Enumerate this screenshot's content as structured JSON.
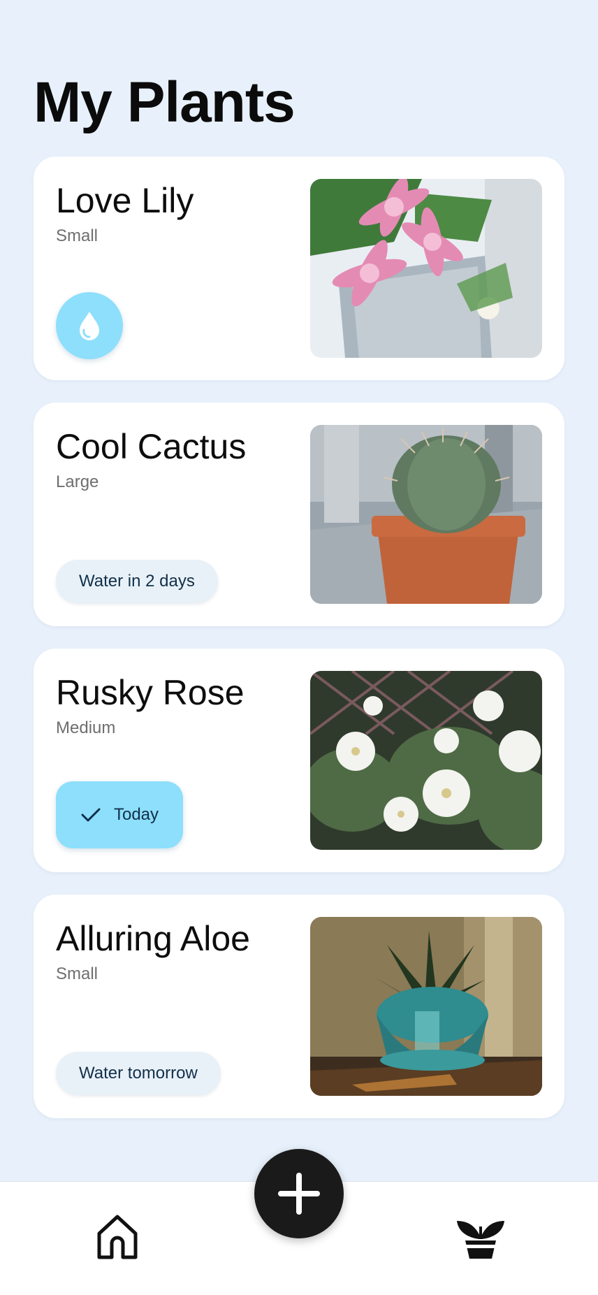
{
  "page": {
    "title": "My Plants"
  },
  "plants": [
    {
      "name": "Love Lily",
      "size": "Small",
      "status": "water-now",
      "icon": "water-drop-icon"
    },
    {
      "name": "Cool Cactus",
      "size": "Large",
      "status_label": "Water in 2 days"
    },
    {
      "name": "Rusky Rose",
      "size": "Medium",
      "status_label": "Today",
      "icon": "checkmark-icon"
    },
    {
      "name": "Alluring Aloe",
      "size": "Small",
      "status_label": "Water tomorrow"
    }
  ],
  "nav": {
    "home_icon": "home-icon",
    "add_icon": "plus-icon",
    "plants_icon": "potted-plant-icon"
  },
  "colors": {
    "background": "#e8f1fb",
    "accent": "#8ddffb",
    "pill": "#e9f1f8",
    "fab": "#1a1a1a"
  }
}
